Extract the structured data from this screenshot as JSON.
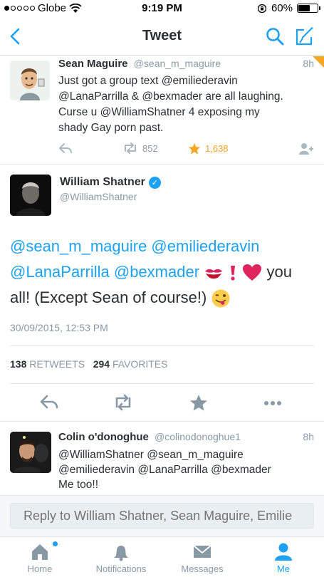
{
  "status_bar": {
    "carrier": "Globe",
    "time": "9:19 PM",
    "battery": "60%",
    "battery_level": 0.6
  },
  "nav": {
    "title": "Tweet",
    "back_icon": "chevron-left-icon",
    "search_icon": "search-icon",
    "compose_icon": "compose-icon"
  },
  "reply_tweet": {
    "name": "Sean Maguire",
    "handle": "@sean_m_maguire",
    "time": "8h",
    "text_lines": [
      "Just got a group text @emiliederavin",
      "@LanaParrilla & @bexmader are all laughing.",
      "Curse u @WilliamShatner 4 exposing my",
      "shady Gay porn past."
    ],
    "retweets": "852",
    "favorites": "1,638"
  },
  "main_tweet": {
    "name": "William Shatner",
    "handle": "@WilliamShatner",
    "mentions_line1": "@sean_m_maguire @emiliederavin",
    "mention_lana": "@LanaParrilla",
    "mention_bex": "@bexmader",
    "text_you": "you",
    "text_line3": "all! (Except Sean of course!)",
    "date": "30/09/2015, 12:53 PM",
    "retweet_count": "138",
    "retweet_label": "RETWEETS",
    "favorite_count": "294",
    "favorite_label": "FAVORITES"
  },
  "colin_tweet": {
    "name": "Colin o'donoghue",
    "handle": "@colinodonoghue1",
    "time": "8h",
    "text_lines": [
      "@WilliamShatner @sean_m_maguire",
      "@emiliederavin @LanaParrilla @bexmader",
      "Me too!!"
    ]
  },
  "reply_bar": {
    "placeholder": "Reply to William Shatner, Sean Maguire, Emilie"
  },
  "tabs": [
    {
      "label": "Home",
      "icon": "home-icon"
    },
    {
      "label": "Notifications",
      "icon": "bell-icon"
    },
    {
      "label": "Messages",
      "icon": "envelope-icon"
    },
    {
      "label": "Me",
      "icon": "person-icon"
    }
  ],
  "colors": {
    "accent": "#1da1f2",
    "favorite": "#f5a623",
    "muted": "#8899a6"
  }
}
